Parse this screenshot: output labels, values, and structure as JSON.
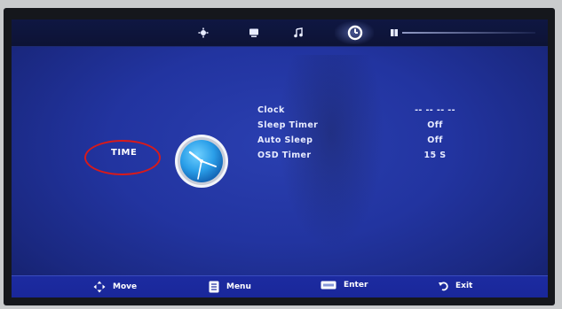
{
  "top_tabs": [
    {
      "icon": "picture-icon"
    },
    {
      "icon": "display-icon"
    },
    {
      "icon": "music-note-icon"
    },
    {
      "icon": "clock-power-icon",
      "active": true
    },
    {
      "icon": "lock-icon"
    }
  ],
  "category": {
    "label": "TIME",
    "icon": "clock-icon"
  },
  "menu": [
    {
      "label": "Clock",
      "value": "-- -- -- --"
    },
    {
      "label": "Sleep Timer",
      "value": "Off"
    },
    {
      "label": "Auto Sleep",
      "value": "Off"
    },
    {
      "label": "OSD Timer",
      "value": "15 S"
    }
  ],
  "hints": [
    {
      "icon": "move-arrows-icon",
      "label": "Move"
    },
    {
      "icon": "menu-icon",
      "label": "Menu"
    },
    {
      "icon": "enter-key-icon",
      "label": "Enter"
    },
    {
      "icon": "exit-arrow-icon",
      "label": "Exit"
    }
  ],
  "colors": {
    "screen_blue": "#2234a0",
    "highlight_red": "#d91a1a",
    "text": "#ffffff"
  }
}
